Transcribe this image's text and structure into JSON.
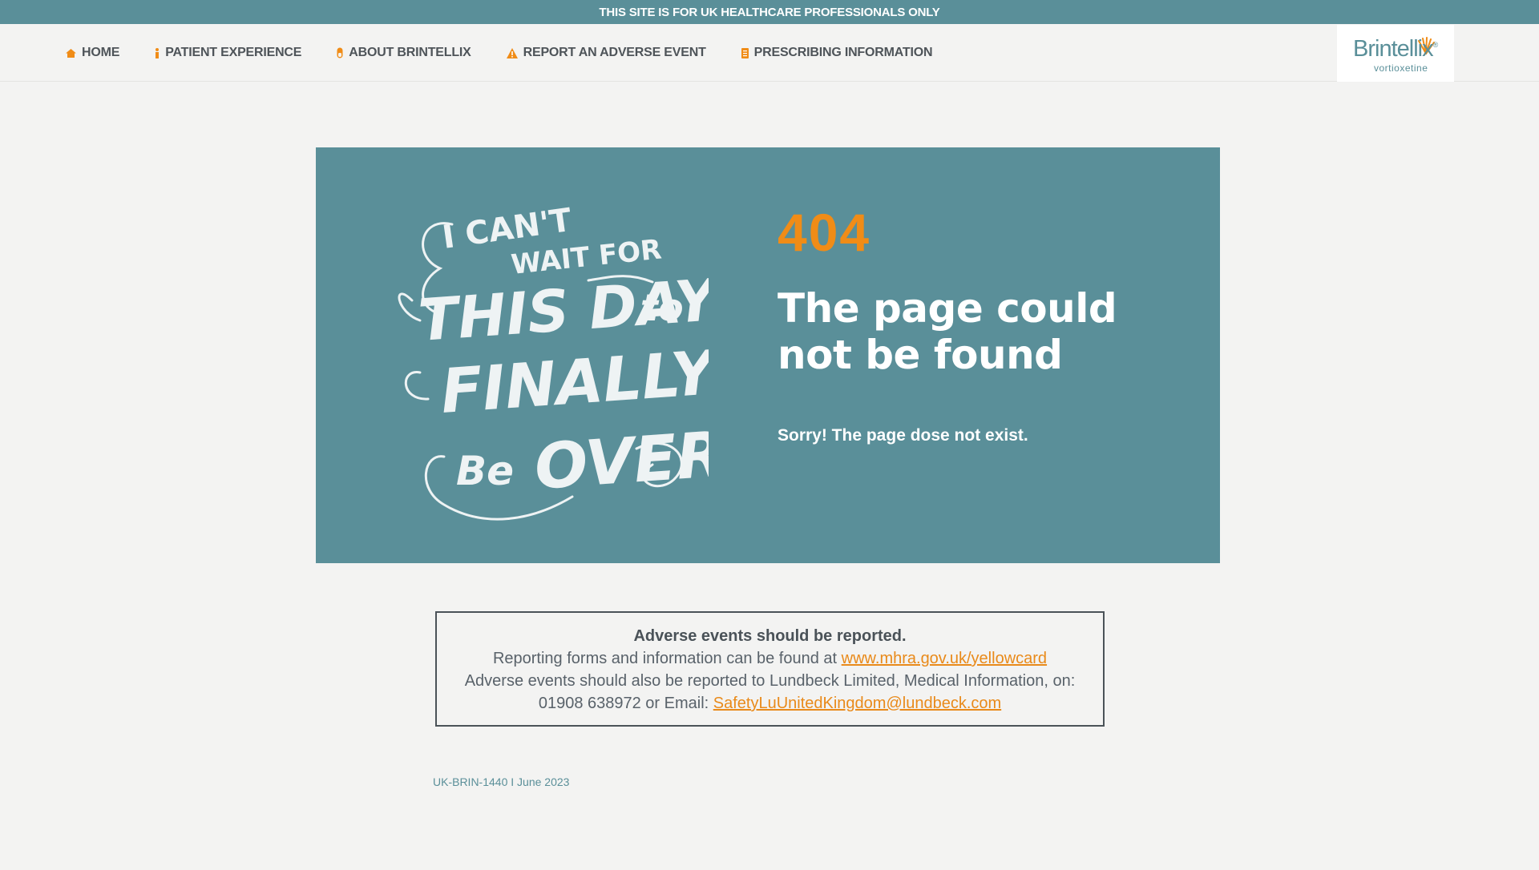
{
  "topbar": {
    "text": "THIS SITE IS FOR UK HEALTHCARE PROFESSIONALS ONLY"
  },
  "nav": {
    "items": [
      {
        "label": "HOME",
        "icon": "home-icon"
      },
      {
        "label": "PATIENT EXPERIENCE",
        "icon": "info-icon"
      },
      {
        "label": "ABOUT BRINTELLIX",
        "icon": "capsule-icon"
      },
      {
        "label": "REPORT AN ADVERSE EVENT",
        "icon": "warning-icon"
      },
      {
        "label": "PRESCRIBING INFORMATION",
        "icon": "document-icon"
      }
    ]
  },
  "logo": {
    "brand": "Brintellix",
    "generic": "vortioxetine"
  },
  "hero": {
    "artwork_lines": [
      "I CAN'T",
      "WAIT FOR",
      "THIS DAY",
      "to",
      "FINALLY",
      "Be",
      "OVER"
    ],
    "error_code": "404",
    "title": "The page could not be found",
    "message": "Sorry! The page dose not exist."
  },
  "adverse": {
    "heading": "Adverse events should be reported.",
    "line1_prefix": "Reporting forms and information can be found at ",
    "line1_link": "www.mhra.gov.uk/yellowcard",
    "line2": "Adverse events should also be reported to Lundbeck Limited, Medical Information, on:",
    "line3_prefix": "01908 638972 or Email: ",
    "line3_link": "SafetyLuUnitedKingdom@lundbeck.com"
  },
  "footer": {
    "code": "UK-BRIN-1440 I June 2023"
  },
  "colors": {
    "teal": "#5a8f99",
    "orange": "#f08c17",
    "text": "#4a5258",
    "background": "#f3f3f2"
  }
}
